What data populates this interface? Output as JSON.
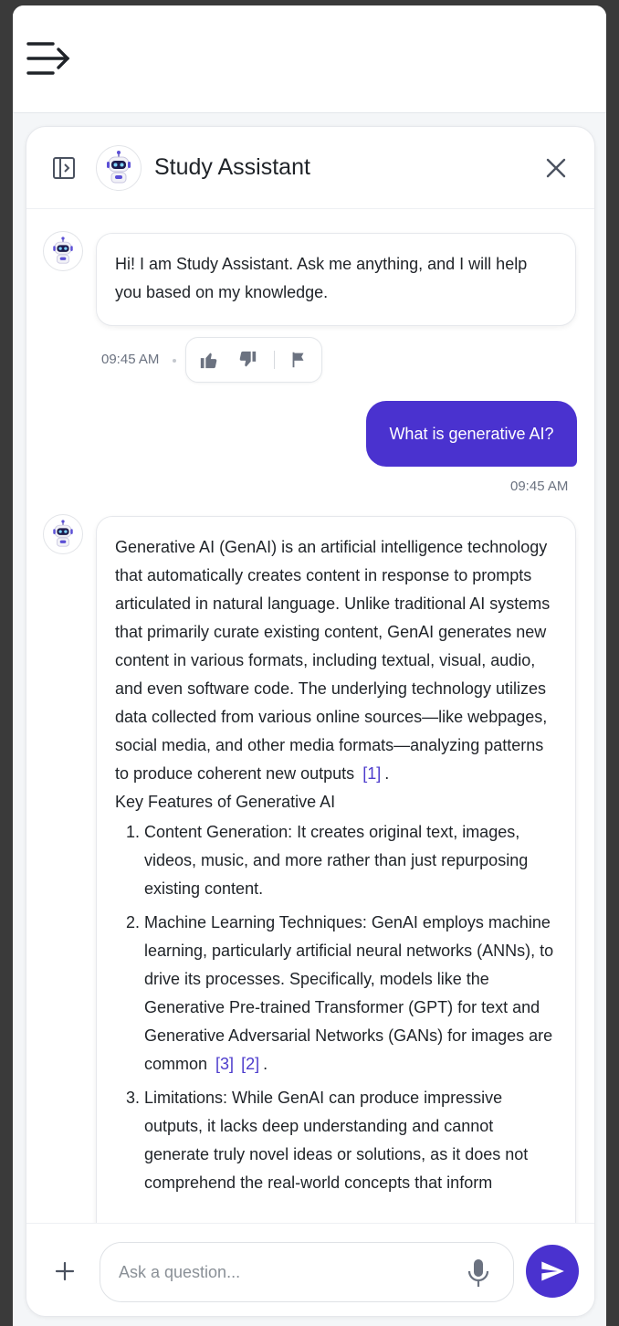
{
  "icons": {
    "menu": "menu-arrow-icon",
    "sidebar": "sidebar-toggle-icon",
    "bot": "robot-icon",
    "close": "close-icon",
    "thumbs_up": "thumbs-up-icon",
    "thumbs_down": "thumbs-down-icon",
    "flag": "flag-icon",
    "add": "plus-icon",
    "mic": "microphone-icon",
    "send": "send-icon"
  },
  "colors": {
    "accent": "#4a32cf",
    "citation": "#4d3ccc"
  },
  "panel": {
    "title": "Study Assistant"
  },
  "messages": {
    "greeting": {
      "text": "Hi! I am Study Assistant. Ask me anything, and I will help you based on my knowledge.",
      "time": "09:45 AM"
    },
    "user": {
      "text": "What is generative AI?",
      "time": "09:45 AM"
    },
    "answer": {
      "intro": "Generative AI (GenAI) is an artificial intelligence technology that automatically creates content in response to prompts articulated in natural language. Unlike traditional AI systems that primarily curate existing content, GenAI generates new content in various formats, including textual, visual, audio, and even software code. The underlying technology utilizes data collected from various online sources—like webpages, social media, and other media formats—analyzing patterns to produce coherent new outputs",
      "intro_cite": "[1]",
      "intro_end": ".",
      "features_title": "Key Features of Generative AI",
      "features": [
        {
          "term": "Content Generation",
          "text": ": It creates original text, images, videos, music, and more rather than just repurposing existing content."
        },
        {
          "term": "Machine Learning Techniques",
          "text": ": GenAI employs machine learning, particularly artificial neural networks (ANNs), to drive its processes. Specifically, models like the Generative Pre-trained Transformer (GPT) for text and Generative Adversarial Networks (GANs) for images are common",
          "cite1": "[3]",
          "cite2": "[2]",
          "end": "."
        },
        {
          "term": "Limitations",
          "text": ": While GenAI can produce impressive outputs, it lacks deep understanding and cannot generate truly novel ideas or solutions, as it does not comprehend the real-world concepts that inform"
        }
      ]
    }
  },
  "composer": {
    "placeholder": "Ask a question..."
  }
}
